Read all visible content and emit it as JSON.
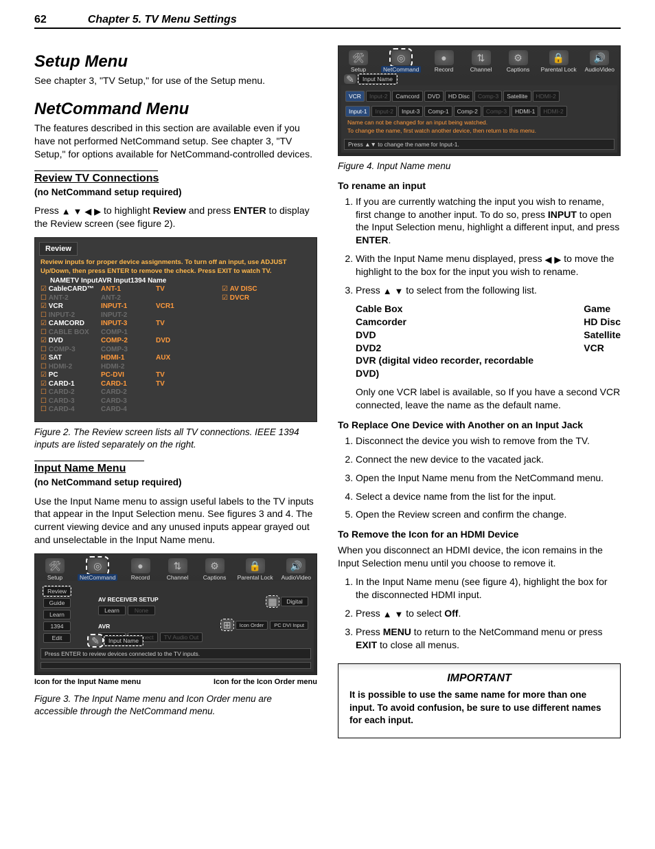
{
  "header": {
    "page": "62",
    "chapter": "Chapter 5. TV Menu Settings"
  },
  "left": {
    "setup_h": "Setup Menu",
    "setup_p": "See chapter 3, \"TV Setup,\" for use of the Setup menu.",
    "nc_h": "NetCommand Menu",
    "nc_p": "The features described in this section are available even if you have not performed NetCommand setup.  See chapter 3, \"TV Setup,\" for options available for NetCommand-controlled devices.",
    "review_h": "Review TV Connections",
    "review_no": "(no NetCommand setup required)",
    "review_p1a": "Press ",
    "review_p1b": " to highlight ",
    "review_p1c": "Review",
    "review_p1d": " and press ",
    "review_p1e": "ENTER",
    "review_p1f": " to display the Review screen (see figure 2).",
    "fig2_title": "Review",
    "fig2_instr1": "Review inputs for proper device assignments. To turn off an input, use ADJUST",
    "fig2_instr2": "Up/Down, then press ENTER to remove the check.  Press EXIT to watch TV.",
    "fig2_hdr": {
      "c1": "NAME",
      "c2": "TV Input",
      "c3": "AVR Input",
      "c4": "1394 Name"
    },
    "fig2_rows_left": [
      {
        "ck": true,
        "on": true,
        "c1": "CableCARD™",
        "c2": "ANT-1",
        "c3": "TV"
      },
      {
        "ck": false,
        "on": false,
        "c1": "ANT-2",
        "c2": "ANT-2",
        "c3": ""
      },
      {
        "ck": true,
        "on": true,
        "c1": "VCR",
        "c2": "INPUT-1",
        "c3": "VCR1"
      },
      {
        "ck": false,
        "on": false,
        "c1": "INPUT-2",
        "c2": "INPUT-2",
        "c3": ""
      },
      {
        "ck": true,
        "on": true,
        "c1": "CAMCORD",
        "c2": "INPUT-3",
        "c3": "TV"
      },
      {
        "ck": false,
        "on": false,
        "c1": "CABLE BOX",
        "c2": "COMP-1",
        "c3": ""
      },
      {
        "ck": true,
        "on": true,
        "c1": "DVD",
        "c2": "COMP-2",
        "c3": "DVD"
      },
      {
        "ck": false,
        "on": false,
        "c1": "COMP-3",
        "c2": "COMP-3",
        "c3": ""
      },
      {
        "ck": true,
        "on": true,
        "c1": "SAT",
        "c2": "HDMI-1",
        "c3": "AUX"
      },
      {
        "ck": false,
        "on": false,
        "c1": "HDMI-2",
        "c2": "HDMI-2",
        "c3": ""
      },
      {
        "ck": true,
        "on": true,
        "c1": "PC",
        "c2": "PC-DVI",
        "c3": "TV"
      },
      {
        "ck": true,
        "on": true,
        "c1": "CARD-1",
        "c2": "CARD-1",
        "c3": "TV"
      },
      {
        "ck": false,
        "on": false,
        "c1": "CARD-2",
        "c2": "CARD-2",
        "c3": ""
      },
      {
        "ck": false,
        "on": false,
        "c1": "CARD-3",
        "c2": "CARD-3",
        "c3": ""
      },
      {
        "ck": false,
        "on": false,
        "c1": "CARD-4",
        "c2": "CARD-4",
        "c3": ""
      }
    ],
    "fig2_1394": [
      {
        "ck": true,
        "name": "AV DISC"
      },
      {
        "ck": true,
        "name": "DVCR"
      }
    ],
    "fig2_cap": "Figure 2.  The Review screen lists all TV connections.  IEEE 1394 inputs are listed separately on the right.",
    "inname_h": "Input Name Menu",
    "inname_no": "(no NetCommand setup required)",
    "inname_p": "Use the Input Name menu to assign useful labels to the TV inputs that appear in the Input Selection menu.  See figures 3 and 4.  The current viewing device and any unused inputs appear grayed out and unselectable in the Input Name menu.",
    "fig3_icons": [
      "Setup",
      "NetCommand",
      "Record",
      "Channel",
      "Captions",
      "Parental Lock",
      "AudioVideo"
    ],
    "fig3_left": [
      "Review",
      "Guide",
      "Learn",
      "1394",
      "Edit"
    ],
    "fig3_avr_hdr": "AV RECEIVER SETUP",
    "fig3_avr_row1": [
      "Learn",
      "None"
    ],
    "fig3_avr_hdr2": "AVR",
    "fig3_avr_row2": [
      "Learn",
      "Connect",
      "TV Audio Out"
    ],
    "fig3_right": [
      "Icon Order",
      "PC DVI Input"
    ],
    "fig3_inputname": "Input Name",
    "fig3_digital": "Digital",
    "fig3_bar": "Press ENTER to review devices connected to the TV inputs.",
    "fig3_cap_l": "Icon for the Input Name menu",
    "fig3_cap_r": "Icon for the  Icon Order menu",
    "fig3_cap": "Figure 3.  The Input Name menu and Icon Order menu are accessible through the NetCommand menu."
  },
  "right": {
    "fig4_icons": [
      "Setup",
      "NetCommand",
      "Record",
      "Channel",
      "Captions",
      "Parental Lock",
      "AudioVideo"
    ],
    "fig4_sel": "Input Name",
    "fig4_row1": [
      "VCR",
      "Input-2",
      "Camcord",
      "DVD",
      "HD Disc",
      "Comp-3",
      "Satellite",
      "HDMI-2"
    ],
    "fig4_row1_state": [
      "a",
      "d",
      "a",
      "a",
      "a",
      "d",
      "a",
      "d"
    ],
    "fig4_row2": [
      "Input-1",
      "Input-2",
      "Input-3",
      "Comp-1",
      "Comp-2",
      "Comp-3",
      "HDMI-1",
      "HDMI-2"
    ],
    "fig4_row2_state": [
      "a",
      "d",
      "a",
      "a",
      "a",
      "d",
      "a",
      "d"
    ],
    "fig4_warn1": "Name can not be changed for an input being watched.",
    "fig4_warn2": "To change the name, first watch another device, then return to this menu.",
    "fig4_bar": "Press ▲▼ to change the name for Input-1.",
    "fig4_cap": "Figure 4.  Input Name menu",
    "rename_h": "To rename an input",
    "rename_1a": "If you are currently watching the input you wish to rename, first change to another input.  To do so, press ",
    "rename_1b": "INPUT",
    "rename_1c": " to open the Input Selection menu, highlight a different input, and press ",
    "rename_1d": "ENTER",
    "rename_1e": ".",
    "rename_2a": "With the Input Name menu displayed, press ",
    "rename_2b": " to move the highlight to the box for the input you wish to rename.",
    "rename_3a": "Press ",
    "rename_3b": " to select from the following list.",
    "names_l": [
      "Cable Box",
      "Camcorder",
      "DVD",
      "DVD2",
      "DVR"
    ],
    "dvr_tail": " (digital video recorder, recordable DVD)",
    "names_r": [
      "Game",
      "HD Disc",
      "Satellite",
      "VCR"
    ],
    "rename_note": "Only one VCR label is available, so If you have a second VCR connected, leave the name as the default name.",
    "replace_h": "To Replace One Device with Another on an Input Jack",
    "replace_steps": [
      "Disconnect the device you wish to remove from the TV.",
      "Connect the new device to the vacated jack.",
      "Open the Input Name menu from the NetCommand menu.",
      "Select a device name from the list for the input.",
      "Open the Review screen and confirm the change."
    ],
    "removehdmi_h": "To Remove the Icon for an HDMI Device",
    "removehdmi_p": "When you disconnect an HDMI device, the icon remains in the Input Selection menu until you choose to remove it.",
    "removehdmi_1": "In the Input Name menu (see figure 4), highlight the box for the disconnected HDMI input.",
    "removehdmi_2a": "Press ",
    "removehdmi_2b": " to select ",
    "removehdmi_2c": "Off",
    "removehdmi_2d": ".",
    "removehdmi_3a": "Press ",
    "removehdmi_3b": "MENU",
    "removehdmi_3c": " to return to the NetCommand menu or press ",
    "removehdmi_3d": "EXIT",
    "removehdmi_3e": " to close all menus.",
    "imp_t": "IMPORTANT",
    "imp_p": "It is possible to use the same name for more than one input.  To avoid confusion, be sure to use different names for each input."
  }
}
